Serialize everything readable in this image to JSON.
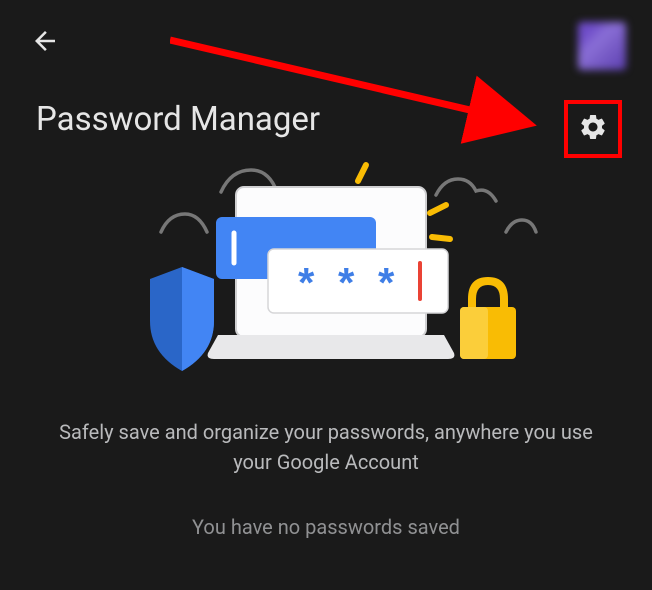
{
  "header": {
    "title": "Password Manager"
  },
  "body": {
    "subtitle": "Safely save and organize your passwords, anywhere you use your Google Account",
    "no_passwords": "You have no passwords saved"
  },
  "annotations": {
    "highlight_color": "#ff0000"
  }
}
